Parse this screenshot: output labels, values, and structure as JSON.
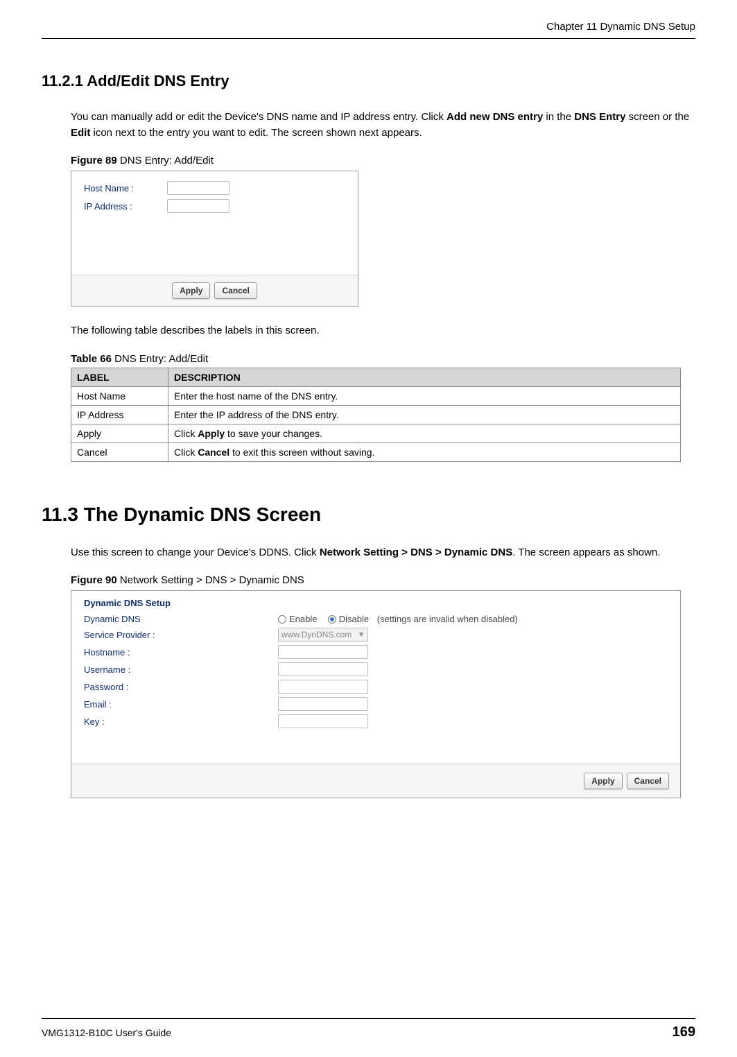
{
  "header": {
    "chapter": "Chapter 11 Dynamic DNS Setup"
  },
  "section_11_2_1": {
    "heading": "11.2.1  Add/Edit DNS Entry",
    "para_pre": "You can manually add or edit the Device's DNS name and IP address entry. Click ",
    "bold1": "Add new DNS entry",
    "para_mid1": " in the ",
    "bold2": "DNS Entry",
    "para_mid2": " screen or the ",
    "bold3": "Edit",
    "para_post": " icon next to the entry you want to edit. The screen shown next appears."
  },
  "figure89": {
    "caption_bold": "Figure 89",
    "caption_rest": "   DNS Entry: Add/Edit",
    "hostname_label": "Host Name :",
    "ipaddress_label": "IP Address :",
    "apply_label": "Apply",
    "cancel_label": "Cancel"
  },
  "table66_intro": "The following table describes the labels in this screen.",
  "table66": {
    "caption_bold": "Table 66",
    "caption_rest": "   DNS Entry: Add/Edit",
    "headers": {
      "label": "LABEL",
      "description": "DESCRIPTION"
    },
    "rows": [
      {
        "label": "Host Name",
        "desc_pre": "Enter the host name of the DNS entry.",
        "desc_bold": "",
        "desc_post": ""
      },
      {
        "label": "IP Address",
        "desc_pre": "Enter the IP address of the DNS entry.",
        "desc_bold": "",
        "desc_post": ""
      },
      {
        "label": "Apply",
        "desc_pre": "Click ",
        "desc_bold": "Apply",
        "desc_post": " to save your changes."
      },
      {
        "label": "Cancel",
        "desc_pre": "Click ",
        "desc_bold": "Cancel",
        "desc_post": " to exit this screen without saving."
      }
    ]
  },
  "section_11_3": {
    "heading": "11.3  The Dynamic DNS Screen",
    "para_pre": "Use this screen to change your Device's DDNS. Click ",
    "bold1": "Network Setting > DNS > Dynamic DNS",
    "para_post": ". The screen appears as shown."
  },
  "figure90": {
    "caption_bold": "Figure 90",
    "caption_rest": "   Network Setting > DNS > Dynamic DNS",
    "panel_title": "Dynamic DNS Setup",
    "rows": {
      "dynamic_dns": "Dynamic DNS",
      "enable": "Enable",
      "disable": "Disable",
      "disable_note": "(settings are invalid when disabled)",
      "service_provider": "Service Provider :",
      "service_provider_value": "www.DynDNS.com",
      "hostname": "Hostname :",
      "username": "Username :",
      "password": "Password :",
      "email": "Email :",
      "key": "Key :"
    },
    "apply_label": "Apply",
    "cancel_label": "Cancel"
  },
  "footer": {
    "guide": "VMG1312-B10C User's Guide",
    "page": "169"
  }
}
